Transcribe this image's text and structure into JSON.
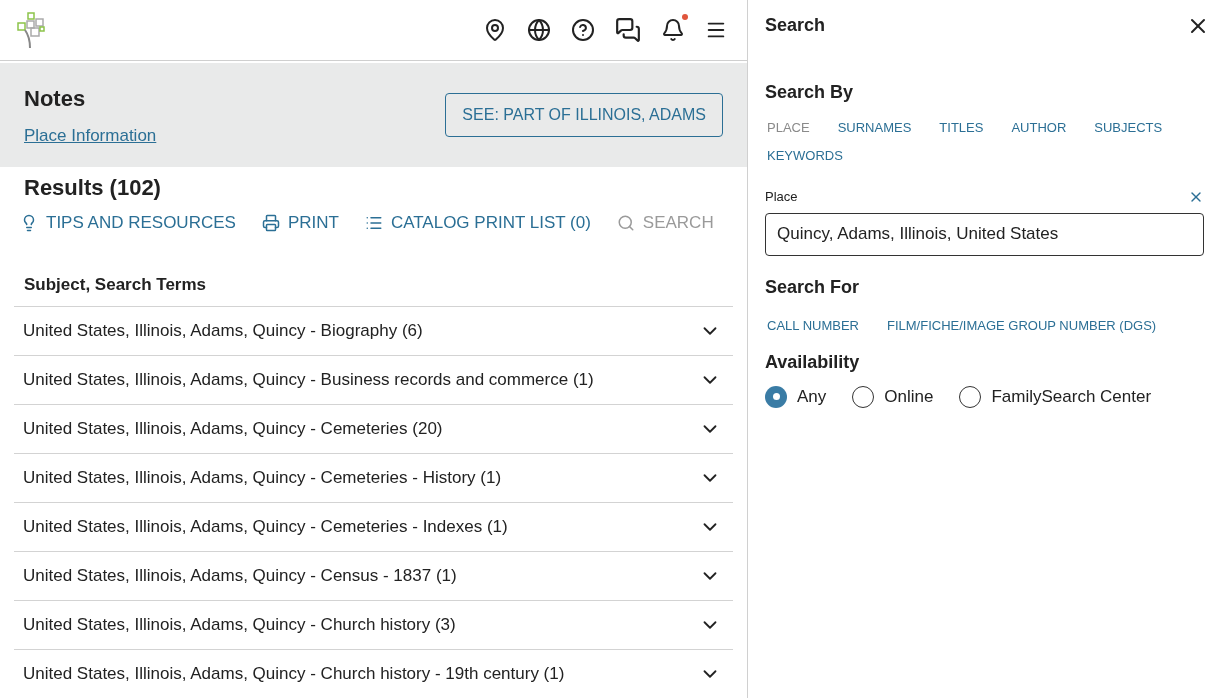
{
  "header": {
    "notification_dot": true
  },
  "notes": {
    "title": "Notes",
    "link": "Place Information",
    "button": "SEE: PART OF ILLINOIS, ADAMS"
  },
  "results": {
    "title": "Results (102)",
    "actions": [
      {
        "kind": "tips",
        "label": "TIPS AND RESOURCES",
        "disabled": false
      },
      {
        "kind": "print",
        "label": "PRINT",
        "disabled": false
      },
      {
        "kind": "list",
        "label": "CATALOG PRINT LIST (0)",
        "disabled": false
      },
      {
        "kind": "search",
        "label": "SEARCH",
        "disabled": true
      }
    ],
    "column": "Subject, Search Terms",
    "rows": [
      {
        "label": "United States, Illinois, Adams, Quincy - Biography (6)",
        "expanded": false
      },
      {
        "label": "United States, Illinois, Adams, Quincy - Business records and commerce (1)",
        "expanded": false
      },
      {
        "label": "United States, Illinois, Adams, Quincy - Cemeteries (20)",
        "expanded": false
      },
      {
        "label": "United States, Illinois, Adams, Quincy - Cemeteries - History (1)",
        "expanded": false
      },
      {
        "label": "United States, Illinois, Adams, Quincy - Cemeteries - Indexes (1)",
        "expanded": false
      },
      {
        "label": "United States, Illinois, Adams, Quincy - Census - 1837 (1)",
        "expanded": false
      },
      {
        "label": "United States, Illinois, Adams, Quincy - Church history (3)",
        "expanded": false
      },
      {
        "label": "United States, Illinois, Adams, Quincy - Church history - 19th century (1)",
        "expanded": false
      }
    ]
  },
  "search_panel": {
    "title": "Search",
    "search_by_title": "Search By",
    "search_by": [
      {
        "label": "PLACE",
        "selected": true
      },
      {
        "label": "SURNAMES",
        "selected": false
      },
      {
        "label": "TITLES",
        "selected": false
      },
      {
        "label": "AUTHOR",
        "selected": false
      },
      {
        "label": "SUBJECTS",
        "selected": false
      },
      {
        "label": "KEYWORDS",
        "selected": false
      }
    ],
    "field_label": "Place",
    "field_value": "Quincy, Adams, Illinois, United States",
    "search_for_title": "Search For",
    "search_for": [
      {
        "label": "CALL NUMBER",
        "selected": false
      },
      {
        "label": "FILM/FICHE/IMAGE GROUP NUMBER (DGS)",
        "selected": false
      }
    ],
    "availability_title": "Availability",
    "availability": [
      {
        "label": "Any",
        "selected": true
      },
      {
        "label": "Online",
        "selected": false
      },
      {
        "label": "FamilySearch Center",
        "selected": false
      }
    ]
  }
}
